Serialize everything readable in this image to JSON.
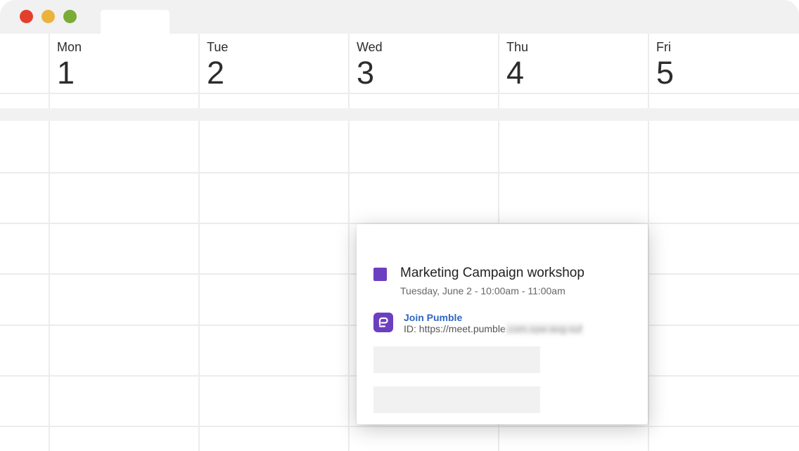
{
  "calendar": {
    "days": [
      {
        "name": "Mon",
        "number": "1"
      },
      {
        "name": "Tue",
        "number": "2"
      },
      {
        "name": "Wed",
        "number": "3"
      },
      {
        "name": "Thu",
        "number": "4"
      },
      {
        "name": "Fri",
        "number": "5"
      }
    ]
  },
  "event_popup": {
    "title": "Marketing Campaign workshop",
    "time": "Tuesday, June 2 - 10:00am - 11:00am",
    "color": "#6b3fbf",
    "join_label": "Join Pumble",
    "meeting_id_label": "ID: https://meet.pumble",
    "meeting_id_hidden": ".com.xyw-avg-xuf",
    "app_icon": "pumble-icon"
  },
  "window": {
    "controls": [
      "close",
      "minimize",
      "maximize"
    ],
    "control_colors": [
      "#e2402d",
      "#ebb33c",
      "#7aab35"
    ]
  }
}
